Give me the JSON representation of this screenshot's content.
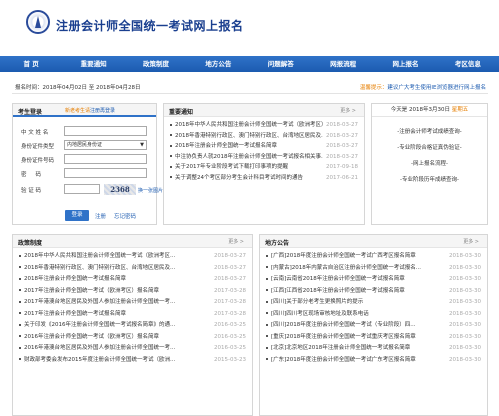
{
  "header": {
    "site_title": "注册会计师全国统一考试网上报名"
  },
  "nav": {
    "items": [
      "首 页",
      "重要通知",
      "政策制度",
      "地方公告",
      "问题解答",
      "网报流程",
      "网上报名",
      "考区信息"
    ]
  },
  "notice_bar": {
    "time_text": "报名时间：2018年04月02日 至 2018年04月28日",
    "tip_label": "温馨提示：",
    "tip_text": "建议广大考生使用IE浏览器进行网上报名"
  },
  "login": {
    "title": "考生登录",
    "new_candidate_label": "新老考生请",
    "new_candidate_link": "注册再登录",
    "fields": {
      "name_label": "中 文 姓 名",
      "id_type_label": "身份证件类型",
      "id_type_value": "内地居民身份证",
      "id_number_label": "身份证件号码",
      "password_label": "密 　 码",
      "captcha_label": "验 证 码"
    },
    "captcha_text": "2368",
    "captcha_refresh": "换一张图片",
    "login_button": "登录",
    "register_link": "注册",
    "forgot_link": "忘记密码"
  },
  "news": {
    "title": "重要通知",
    "more": "更多 >",
    "items": [
      {
        "text": "2018年中华人民共和国注册会计师全国统一考试（欧洲考区）...",
        "date": "2018-03-27",
        "style": "blue"
      },
      {
        "text": "2018年香港特别行政区、澳门特别行政区、台湾地区居民及...",
        "date": "2018-03-27",
        "style": "blue"
      },
      {
        "text": "2018年注册会计师全国统一考试报名简章",
        "date": "2018-03-27",
        "style": "blue"
      },
      {
        "text": "中注协负责人就2018年注册会计师全国统一考试报名相关事...",
        "date": "2018-03-27",
        "style": "blue"
      },
      {
        "text": "关于2017年专业阶段考试下载打印事项的提醒",
        "date": "2017-09-18",
        "style": "normal"
      },
      {
        "text": "关于调整24个考区部分考生会计科目考试时间的通告",
        "date": "2017-06-21",
        "style": "normal"
      }
    ]
  },
  "date_box": {
    "date_text": "今天是 2018年3月30日",
    "weekday": "星期五",
    "links": [
      "-注册会计师考试成绩查询-",
      "-专业阶段合格证真伪验证-",
      "-网上报名流程-",
      "-专业阶段历年成绩查询-"
    ]
  },
  "policy": {
    "title": "政策制度",
    "more": "更多 >",
    "items": [
      {
        "text": "2018年中华人民共和国注册会计师全国统一考试（欧洲考区...",
        "date": "2018-03-27"
      },
      {
        "text": "2018年香港特别行政区、澳门特别行政区、台湾地区居民及...",
        "date": "2018-03-27"
      },
      {
        "text": "2018年注册会计师全国统一考试报名简章",
        "date": "2018-03-27"
      },
      {
        "text": "2017年注册会计师全国统一考试（欧洲考区）报名简章",
        "date": "2017-03-28"
      },
      {
        "text": "2017年港澳台地区居民及外国人参加注册会计师全国统一考...",
        "date": "2017-03-28"
      },
      {
        "text": "2017年注册会计师全国统一考试报名简章",
        "date": "2017-03-28"
      },
      {
        "text": "关于印发《2016年注册会计师全国统一考试报名简章》的通...",
        "date": "2016-03-25"
      },
      {
        "text": "2016年注册会计师全国统一考试（欧洲考区）报名简章",
        "date": "2016-03-25"
      },
      {
        "text": "2016年港澳台地区居民及外国人参加注册会计师全国统一考...",
        "date": "2016-03-25"
      },
      {
        "text": "财政部考委会发布2015年度注册会计师全国统一考试（欧洲...",
        "date": "2015-03-23"
      }
    ]
  },
  "announce": {
    "title": "地方公告",
    "more": "更多 >",
    "items": [
      {
        "text": "[广西]2018年度注册会计师全国统一考试广西考区报名简章",
        "date": "2018-03-30"
      },
      {
        "text": "[内蒙古]2018年内蒙古自治区注册会计师全国统一考试报名...",
        "date": "2018-03-30"
      },
      {
        "text": "[云南]云南省2018年注册会计师全国统一考试报名简章",
        "date": "2018-03-30"
      },
      {
        "text": "[江西]江西省2018年注册会计师全国统一考试报名简章",
        "date": "2018-03-30"
      },
      {
        "text": "[四川]关于部分老考生更换照片的提示",
        "date": "2018-03-30"
      },
      {
        "text": "[四川]四川考区现场审核地址及联系电话",
        "date": "2018-03-30"
      },
      {
        "text": "[四川]2018年度注册会计师全国统一考试（专业阶段）四...",
        "date": "2018-03-30"
      },
      {
        "text": "[重庆]2018年度注册会计师全国统一考试重庆考区报名简章",
        "date": "2018-03-30"
      },
      {
        "text": "[北京]北京地区2018年注册会计师全国统一考试报名简章",
        "date": "2018-03-30"
      },
      {
        "text": "[广东]2018年度注册会计师全国统一考试广东考区报名简章",
        "date": "2018-03-30"
      }
    ]
  }
}
